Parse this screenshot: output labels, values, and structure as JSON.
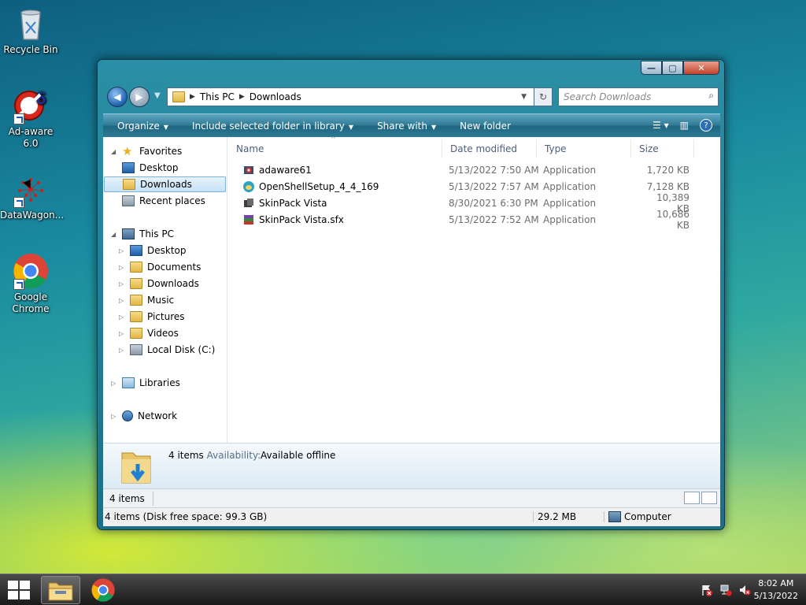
{
  "desktop": {
    "icons": [
      {
        "label": "Recycle Bin",
        "icon": "recycle-bin-icon"
      },
      {
        "label": "Ad-aware 6.0",
        "icon": "adaware-icon"
      },
      {
        "label": "DataWagon...",
        "icon": "datawagon-icon"
      },
      {
        "label": "Google Chrome",
        "icon": "chrome-icon"
      }
    ]
  },
  "window": {
    "controls": {
      "minimize": "—",
      "maximize": "▢",
      "close": "✕"
    },
    "address": {
      "root": "This PC",
      "current": "Downloads"
    },
    "search": {
      "placeholder": "Search Downloads"
    },
    "toolbar": {
      "organize": "Organize",
      "include": "Include selected folder in library",
      "share": "Share with",
      "new_folder": "New folder"
    },
    "nav": {
      "favorites": "Favorites",
      "fav_items": [
        "Desktop",
        "Downloads",
        "Recent places"
      ],
      "this_pc": "This PC",
      "pc_items": [
        "Desktop",
        "Documents",
        "Downloads",
        "Music",
        "Pictures",
        "Videos",
        "Local Disk (C:)"
      ],
      "libraries": "Libraries",
      "network": "Network",
      "selected": "Downloads"
    },
    "columns": {
      "name": "Name",
      "date": "Date modified",
      "type": "Type",
      "size": "Size"
    },
    "files": [
      {
        "name": "adaware61",
        "date": "5/13/2022 7:50 AM",
        "type": "Application",
        "size": "1,720 KB",
        "icon": "adaware-app-icon"
      },
      {
        "name": "OpenShellSetup_4_4_169",
        "date": "5/13/2022 7:57 AM",
        "type": "Application",
        "size": "7,128 KB",
        "icon": "openshell-app-icon"
      },
      {
        "name": "SkinPack Vista",
        "date": "8/30/2021 6:30 PM",
        "type": "Application",
        "size": "10,389 KB",
        "icon": "skinpack-app-icon"
      },
      {
        "name": "SkinPack Vista.sfx",
        "date": "5/13/2022 7:52 AM",
        "type": "Application",
        "size": "10,686 KB",
        "icon": "sfx-archive-icon"
      }
    ],
    "details": {
      "count": "4 items",
      "availability_label": "Availability:",
      "availability_value": "Available offline"
    },
    "status": {
      "items": "4 items",
      "disk": "4 items (Disk free space: 99.3 GB)",
      "size": "29.2 MB",
      "location": "Computer"
    }
  },
  "taskbar": {
    "clock_time": "8:02 AM",
    "clock_date": "5/13/2022",
    "apps": [
      "file-explorer-icon",
      "chrome-icon"
    ]
  }
}
